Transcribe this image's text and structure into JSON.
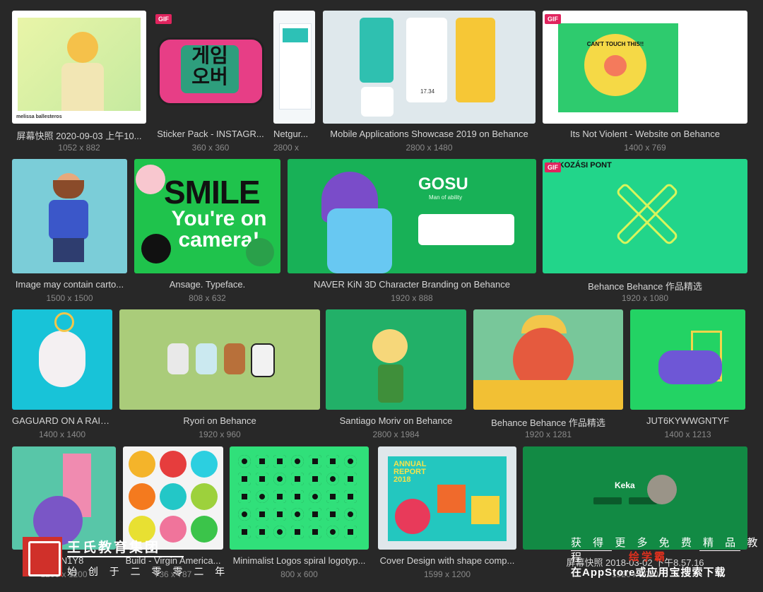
{
  "gif_label": "GIF",
  "colors": {
    "background": "#282828",
    "gif_badge": "#e0245e",
    "caption": "#d6d6d6",
    "dims": "#8a8a8a"
  },
  "items": [
    {
      "caption": "屏幕快照 2020-09-03 上午10...",
      "dims": "1052 x 882",
      "thumb_text": "melissa ballesteros"
    },
    {
      "caption": "Sticker Pack - INSTAGR...",
      "dims": "360 x 360",
      "thumb_text": "게임\n오버"
    },
    {
      "caption": "Netgur...",
      "dims": "2800 x"
    },
    {
      "caption": "Mobile Applications Showcase 2019 on Behance",
      "dims": "2800 x 1480",
      "thumb_text": "17.34"
    },
    {
      "caption": "Its Not Violent - Website on Behance",
      "dims": "1400 x 769",
      "thumb_text": "CAN'T TOUCH THIS!!"
    },
    {
      "caption": "Image may contain carto...",
      "dims": "1500 x 1500"
    },
    {
      "caption": "Ansage. Typeface.",
      "dims": "808 x 632",
      "thumb_text": "SMILE",
      "thumb_text2": "You're on camera!"
    },
    {
      "caption": "NAVER KiN 3D Character Branding on Behance",
      "dims": "1920 x 888",
      "thumb_text": "GOSU",
      "thumb_text2": "Man of ability"
    },
    {
      "caption": "Behance Behance 作品精选",
      "dims": "1920 x 1080",
      "thumb_text": "ÁLKOZÁSI PONT"
    },
    {
      "caption": "GAGUARD ON A RAIN...",
      "dims": "1400 x 1400"
    },
    {
      "caption": "Ryori on Behance",
      "dims": "1920 x 960"
    },
    {
      "caption": "Santiago Moriv on Behance",
      "dims": "2800 x 1984"
    },
    {
      "caption": "Behance Behance 作品精选",
      "dims": "1920 x 1281"
    },
    {
      "caption": "JUT6KYWWGNTYF",
      "dims": "1400 x 1213"
    },
    {
      "caption": "PIMN1Y8",
      "dims": "1200 x 1200"
    },
    {
      "caption": "Build - Virgin America...",
      "dims": "736 x 787"
    },
    {
      "caption": "Minimalist Logos spiral logotyp...",
      "dims": "800 x 600"
    },
    {
      "caption": "Cover Design with shape comp...",
      "dims": "1599 x 1200",
      "thumb_text": "ANNUAL REPORT 2018"
    },
    {
      "caption": "屏幕快照 2018-03-02 下午8.57.16",
      "dims": "1920 x 1080",
      "thumb_text": "Keka"
    }
  ],
  "watermark": {
    "brand_left": "王氏教育集团",
    "brand_sub": "始 创 于 二 零 零 二 年",
    "promo_line1": "获 得 更 多 免 费 精 品 教 程",
    "promo_brand": "绘学霸",
    "promo_line2": "在AppStore或应用宝搜索下载"
  }
}
